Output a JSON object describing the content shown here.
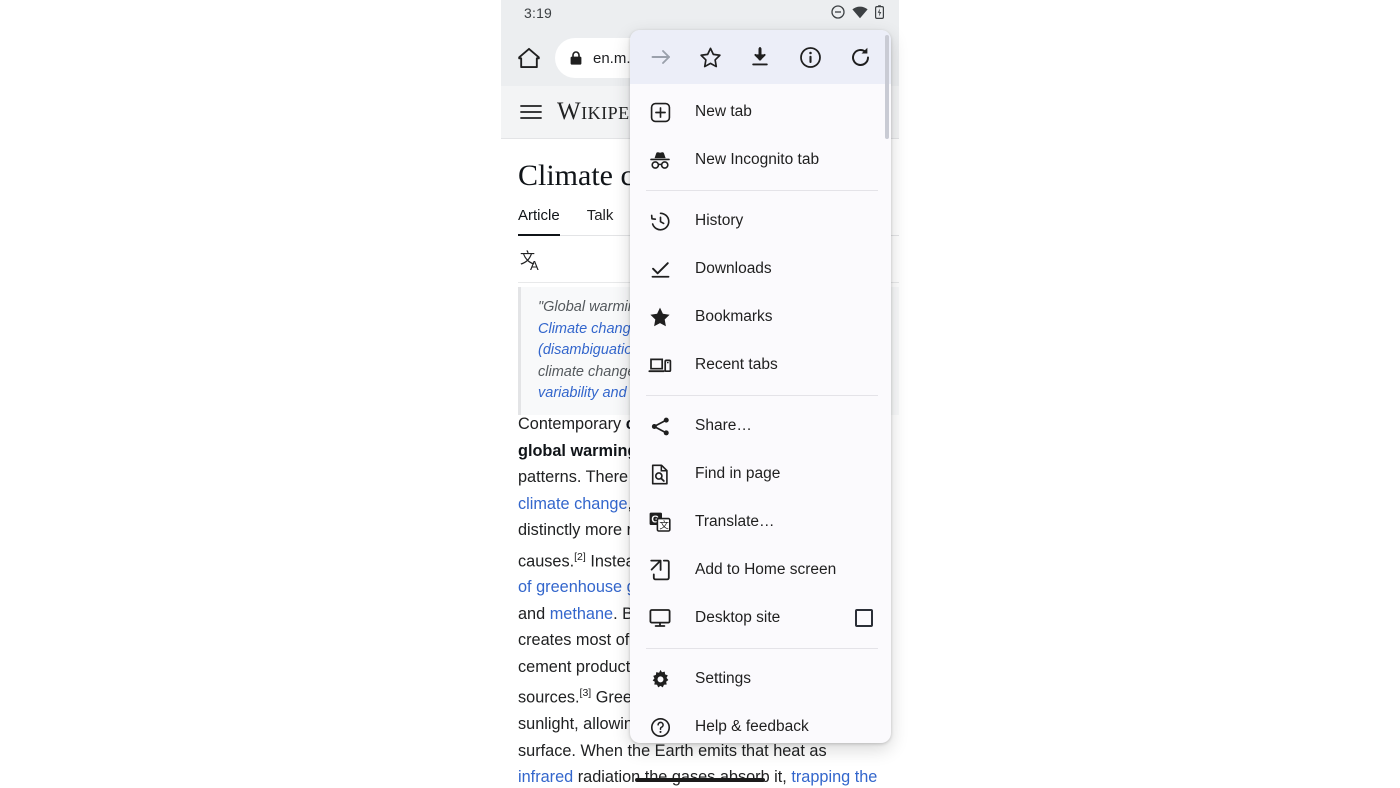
{
  "status_bar": {
    "clock": "3:19",
    "icons": [
      "do-not-disturb-icon",
      "wifi-icon",
      "battery-icon"
    ]
  },
  "browser": {
    "home_icon": "home-icon",
    "lock_icon": "lock-icon",
    "url": "en.m.w"
  },
  "wikipedia": {
    "hamburger_icon": "hamburger-menu-icon",
    "wordmark_w": "W",
    "wordmark_rest": "IKIPE",
    "title": "Climate c",
    "tabs": [
      {
        "label": "Article",
        "active": true
      },
      {
        "label": "Talk",
        "active": false
      }
    ],
    "language_icon": "language-translate-icon",
    "hatnote_lines": [
      {
        "parts": [
          {
            "text": "\"Global warming",
            "type": "plain"
          }
        ]
      },
      {
        "parts": [
          {
            "text": "Climate change ",
            "type": "link"
          }
        ]
      },
      {
        "parts": [
          {
            "text": "(disambiguation)",
            "type": "link"
          }
        ]
      },
      {
        "parts": [
          {
            "text": "climate change.",
            "type": "plain"
          }
        ]
      },
      {
        "parts": [
          {
            "text": "variability and ch",
            "type": "link"
          }
        ]
      }
    ],
    "body_lines": [
      {
        "parts": [
          {
            "t": "Contemporary ",
            "s": "plain"
          },
          {
            "t": "c",
            "s": "bold"
          }
        ]
      },
      {
        "parts": [
          {
            "t": "global warming",
            "s": "bold"
          }
        ]
      },
      {
        "parts": [
          {
            "t": "patterns. There",
            "s": "plain"
          }
        ]
      },
      {
        "parts": [
          {
            "t": "climate change",
            "s": "link"
          },
          {
            "t": ",",
            "s": "plain"
          }
        ]
      },
      {
        "parts": [
          {
            "t": "distinctly more r",
            "s": "plain"
          }
        ]
      },
      {
        "parts": [
          {
            "t": "causes.",
            "s": "plain"
          },
          {
            "t": "[2]",
            "s": "sup"
          },
          {
            "t": " Instea",
            "s": "plain"
          }
        ]
      },
      {
        "parts": [
          {
            "t": "of greenhouse g",
            "s": "link"
          }
        ]
      },
      {
        "parts": [
          {
            "t": "and ",
            "s": "plain"
          },
          {
            "t": "methane",
            "s": "link"
          },
          {
            "t": ". B",
            "s": "plain"
          }
        ]
      },
      {
        "parts": [
          {
            "t": "creates most of",
            "s": "plain"
          }
        ]
      },
      {
        "parts": [
          {
            "t": "cement product",
            "s": "plain"
          }
        ]
      },
      {
        "parts": [
          {
            "t": "sources.",
            "s": "plain"
          },
          {
            "t": "[3]",
            "s": "sup"
          },
          {
            "t": " Gree",
            "s": "plain"
          }
        ]
      },
      {
        "parts": [
          {
            "t": "sunlight, allowin",
            "s": "plain"
          }
        ]
      },
      {
        "parts": [
          {
            "t": "surface. When the Earth emits that heat as",
            "s": "plain"
          }
        ]
      },
      {
        "parts": [
          {
            "t": "infrared",
            "s": "link"
          },
          {
            "t": " radiation the gases absorb it, ",
            "s": "plain"
          },
          {
            "t": "trapping the",
            "s": "link"
          }
        ]
      }
    ]
  },
  "menu": {
    "toolbar": [
      {
        "name": "forward-arrow-icon",
        "label": "Forward",
        "disabled": true
      },
      {
        "name": "star-outline-icon",
        "label": "Bookmark",
        "disabled": false
      },
      {
        "name": "download-icon",
        "label": "Download page",
        "disabled": false
      },
      {
        "name": "info-circle-icon",
        "label": "Page info",
        "disabled": false
      },
      {
        "name": "reload-icon",
        "label": "Reload",
        "disabled": false
      }
    ],
    "items": [
      {
        "id": "new-tab",
        "icon": "plus-square-icon",
        "label": "New tab",
        "type": "item"
      },
      {
        "id": "new-incognito-tab",
        "icon": "incognito-icon",
        "label": "New Incognito tab",
        "type": "item"
      },
      {
        "id": "divider-1",
        "type": "divider"
      },
      {
        "id": "history",
        "icon": "history-clock-icon",
        "label": "History",
        "type": "item"
      },
      {
        "id": "downloads",
        "icon": "downloads-check-icon",
        "label": "Downloads",
        "type": "item"
      },
      {
        "id": "bookmarks",
        "icon": "star-filled-icon",
        "label": "Bookmarks",
        "type": "item"
      },
      {
        "id": "recent-tabs",
        "icon": "recent-tabs-icon",
        "label": "Recent tabs",
        "type": "item"
      },
      {
        "id": "divider-2",
        "type": "divider"
      },
      {
        "id": "share",
        "icon": "share-icon",
        "label": "Share…",
        "type": "item"
      },
      {
        "id": "find-in-page",
        "icon": "find-in-page-icon",
        "label": "Find in page",
        "type": "item"
      },
      {
        "id": "translate",
        "icon": "translate-icon",
        "label": "Translate…",
        "type": "item"
      },
      {
        "id": "add-to-home-screen",
        "icon": "add-to-home-screen-icon",
        "label": "Add to Home screen",
        "type": "item"
      },
      {
        "id": "desktop-site",
        "icon": "desktop-monitor-icon",
        "label": "Desktop site",
        "type": "checkbox",
        "checked": false
      },
      {
        "id": "divider-3",
        "type": "divider"
      },
      {
        "id": "settings",
        "icon": "gear-icon",
        "label": "Settings",
        "type": "item"
      },
      {
        "id": "help-and-feedback",
        "icon": "help-circle-icon",
        "label": "Help & feedback",
        "type": "item"
      }
    ]
  },
  "colors": {
    "menu_bg": "#fbfafd",
    "menu_toolbar_bg": "#eceef8",
    "link_blue": "#3366cc",
    "text": "#1f1f1f",
    "chrome_bg": "#eceef0"
  }
}
